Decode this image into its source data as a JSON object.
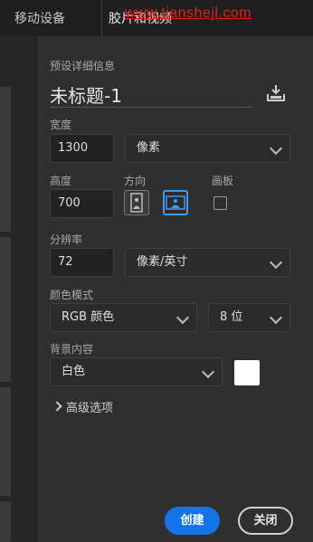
{
  "tabs": [
    {
      "label": "移动设备"
    },
    {
      "label": "胶片和视频"
    }
  ],
  "watermark": "www.tianshejl.com",
  "preset": {
    "section_title": "预设详细信息",
    "title_value": "未标题-1",
    "save_icon": "save-preset-icon"
  },
  "width": {
    "label": "宽度",
    "value": "1300",
    "unit": "像素"
  },
  "height": {
    "label": "高度",
    "value": "700"
  },
  "orientation": {
    "label": "方向",
    "selected": "landscape"
  },
  "artboard": {
    "label": "画板",
    "checked": false
  },
  "resolution": {
    "label": "分辨率",
    "value": "72",
    "unit": "像素/英寸"
  },
  "color_mode": {
    "label": "颜色模式",
    "mode": "RGB 颜色",
    "bits": "8 位"
  },
  "background": {
    "label": "背景内容",
    "value": "白色",
    "swatch_color": "#ffffff"
  },
  "advanced": {
    "label": "高级选项"
  },
  "buttons": {
    "create": "创建",
    "close": "关闭"
  },
  "colors": {
    "accent": "#1473e6",
    "selected_orientation_border": "#3f9bf2"
  }
}
